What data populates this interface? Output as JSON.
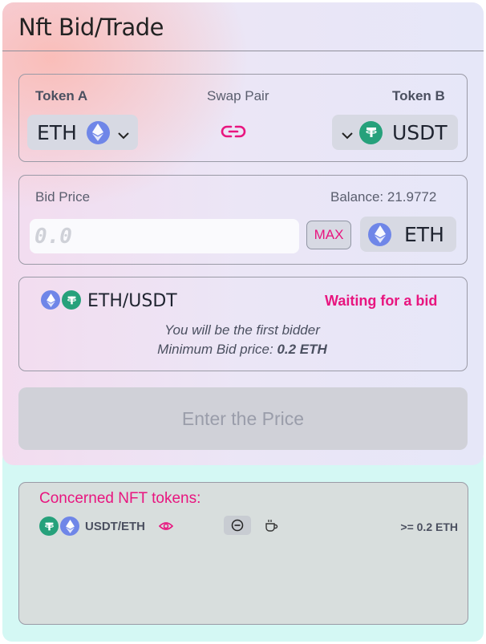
{
  "header": {
    "title": "Nft Bid/Trade"
  },
  "swap": {
    "token_a_label": "Token A",
    "swap_pair_label": "Swap Pair",
    "token_b_label": "Token B",
    "token_a_symbol": "ETH",
    "token_b_symbol": "USDT"
  },
  "bid": {
    "label": "Bid Price",
    "balance": "Balance: 21.9772",
    "placeholder": "0.0",
    "max_label": "MAX",
    "currency": "ETH"
  },
  "info": {
    "pair": "ETH/USDT",
    "status": "Waiting for a bid",
    "first_bidder_text": "You will be the first bidder",
    "min_bid_label": "Minimum Bid price:",
    "min_bid_value": "0.2 ETH"
  },
  "action": {
    "submit_label": "Enter the Price"
  },
  "nft": {
    "title": "Concerned NFT tokens:",
    "rows": [
      {
        "pair": "USDT/ETH",
        "amount": ">= 0.2 ETH"
      }
    ]
  },
  "colors": {
    "accent": "#e8157f",
    "eth": "#6f86e8",
    "usdt": "#26a17b",
    "bottom_panel": "#d4f8f4"
  }
}
